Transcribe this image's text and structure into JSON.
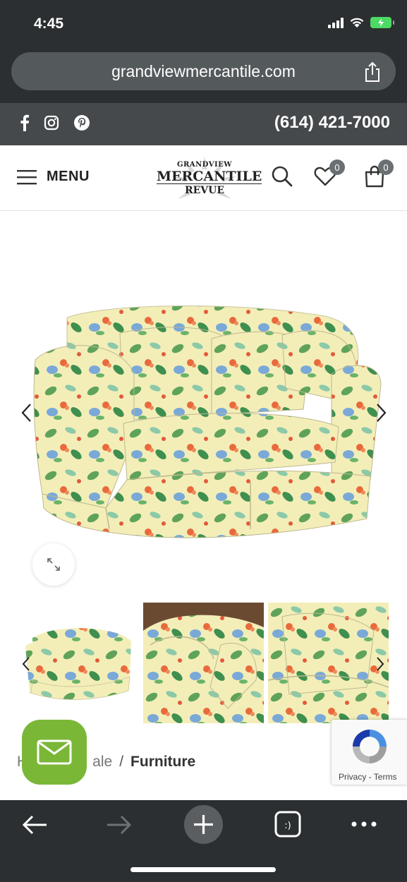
{
  "status": {
    "time": "4:45"
  },
  "browser": {
    "url": "grandviewmercantile.com"
  },
  "topbar": {
    "social_icons": [
      "facebook-icon",
      "instagram-icon",
      "pinterest-icon"
    ],
    "phone": "(614) 421-7000"
  },
  "header": {
    "menu_label": "MENU",
    "logo": {
      "line1": "GRANDVIEW",
      "line2": "MERCANTILE",
      "line3": "REVUE"
    },
    "wishlist_count": "0",
    "cart_count": "0"
  },
  "product": {
    "main_image_alt": "Floral upholstered loveseat",
    "thumbnails": [
      "loveseat front view",
      "loveseat arm detail",
      "loveseat cushion detail"
    ]
  },
  "breadcrumb": {
    "items": [
      "H",
      "ale"
    ],
    "current": "Furniture",
    "separator": "/"
  },
  "recaptcha": {
    "privacy": "Privacy",
    "dash": " - ",
    "terms": "Terms"
  },
  "colors": {
    "chrome": "#2b2f31",
    "topbar": "#45494b",
    "fab": "#7ab737",
    "battery": "#4cd964"
  }
}
